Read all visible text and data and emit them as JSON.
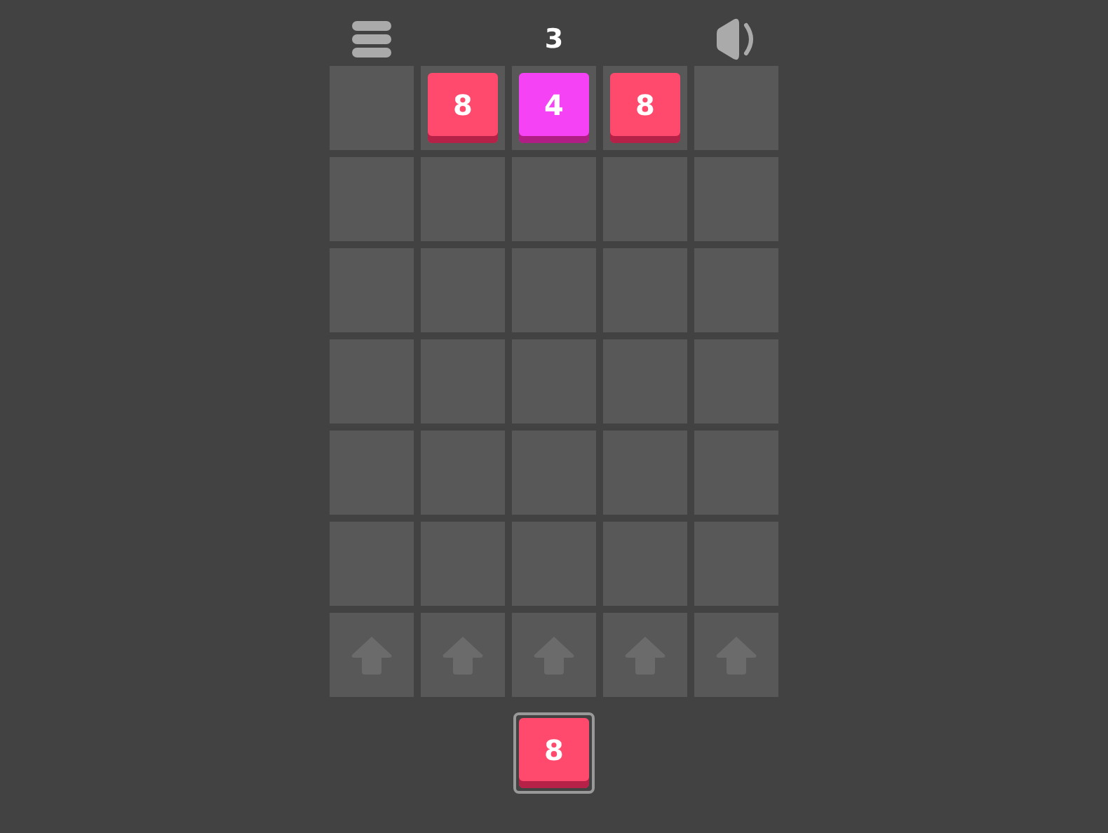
{
  "score": "3",
  "board": [
    [
      {
        "kind": "empty"
      },
      {
        "kind": "tile",
        "value": "8",
        "color": "#ff4a6e"
      },
      {
        "kind": "tile",
        "value": "4",
        "color": "#f442f4"
      },
      {
        "kind": "tile",
        "value": "8",
        "color": "#ff4a6e"
      },
      {
        "kind": "empty"
      }
    ],
    [
      {
        "kind": "empty"
      },
      {
        "kind": "empty"
      },
      {
        "kind": "empty"
      },
      {
        "kind": "empty"
      },
      {
        "kind": "empty"
      }
    ],
    [
      {
        "kind": "empty"
      },
      {
        "kind": "empty"
      },
      {
        "kind": "empty"
      },
      {
        "kind": "empty"
      },
      {
        "kind": "empty"
      }
    ],
    [
      {
        "kind": "empty"
      },
      {
        "kind": "empty"
      },
      {
        "kind": "empty"
      },
      {
        "kind": "empty"
      },
      {
        "kind": "empty"
      }
    ],
    [
      {
        "kind": "empty"
      },
      {
        "kind": "empty"
      },
      {
        "kind": "empty"
      },
      {
        "kind": "empty"
      },
      {
        "kind": "empty"
      }
    ],
    [
      {
        "kind": "empty"
      },
      {
        "kind": "empty"
      },
      {
        "kind": "empty"
      },
      {
        "kind": "empty"
      },
      {
        "kind": "empty"
      }
    ]
  ],
  "drop_row": [
    {
      "kind": "arrow"
    },
    {
      "kind": "arrow"
    },
    {
      "kind": "arrow"
    },
    {
      "kind": "arrow"
    },
    {
      "kind": "arrow"
    }
  ],
  "next_tile": {
    "value": "8",
    "color": "#ff4a6e"
  }
}
